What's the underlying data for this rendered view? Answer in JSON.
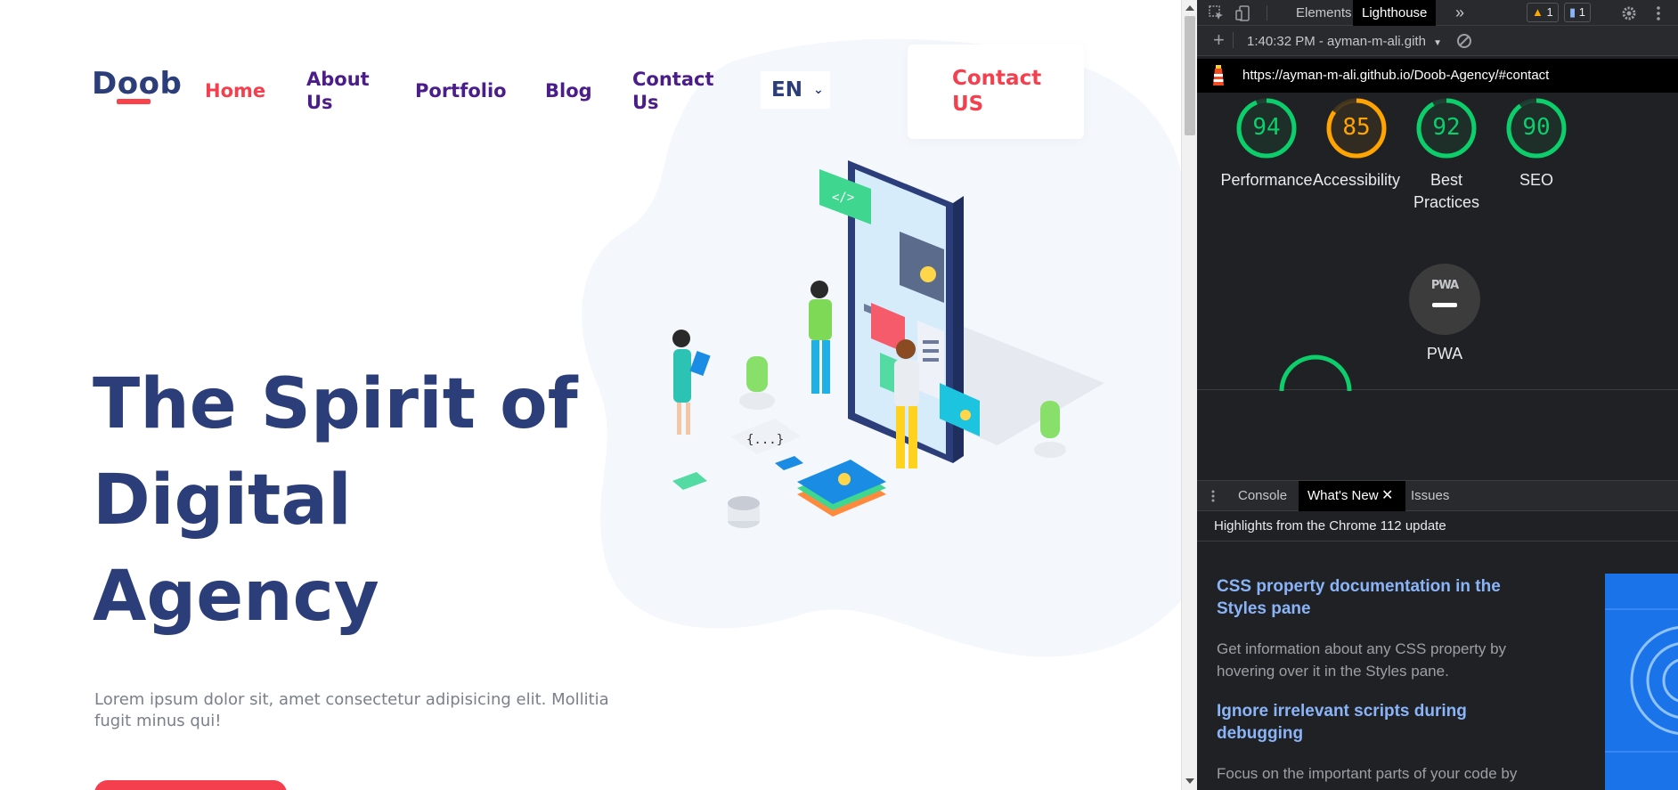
{
  "website": {
    "logo": "Doob",
    "nav": {
      "home": "Home",
      "about": "About Us",
      "portfolio": "Portfolio",
      "blog": "Blog",
      "contact": "Contact Us"
    },
    "language": "EN",
    "contact_cta": "Contact US",
    "hero": {
      "title_lines": [
        "The Spirit of",
        "Digital",
        "Agency"
      ],
      "description": "Lorem ipsum dolor sit, amet consectetur adipisicing elit. Mollitia fugit minus qui!"
    },
    "colors": {
      "brand_navy": "#2c3e7a",
      "brand_red": "#f43f4f",
      "nav_purple": "#4b1d8a"
    }
  },
  "devtools": {
    "tabs": {
      "elements": "Elements",
      "lighthouse": "Lighthouse",
      "more": "»"
    },
    "badges": {
      "warnings": "1",
      "messages": "1"
    },
    "report_label": "1:40:32 PM - ayman-m-ali.gith",
    "url": "https://ayman-m-ali.github.io/Doob-Agency/#contact",
    "scores": [
      {
        "label": "Performance",
        "value": 94,
        "color": "#0cce6b"
      },
      {
        "label": "Accessibility",
        "value": 85,
        "color": "#ffa400"
      },
      {
        "label": "Best Practices",
        "value": 92,
        "color": "#0cce6b"
      },
      {
        "label": "SEO",
        "value": 90,
        "color": "#0cce6b"
      }
    ],
    "pwa": {
      "badge": "PWA",
      "label": "PWA"
    },
    "drawer": {
      "tabs": {
        "console": "Console",
        "whats_new": "What's New",
        "issues": "Issues"
      },
      "highlights": "Highlights from the Chrome 112 update",
      "items": [
        {
          "title": "CSS property documentation in the Styles pane",
          "desc": "Get information about any CSS property by hovering over it in the Styles pane."
        },
        {
          "title": "Ignore irrelevant scripts during debugging",
          "desc": "Focus on the important parts of your code by"
        }
      ]
    }
  }
}
